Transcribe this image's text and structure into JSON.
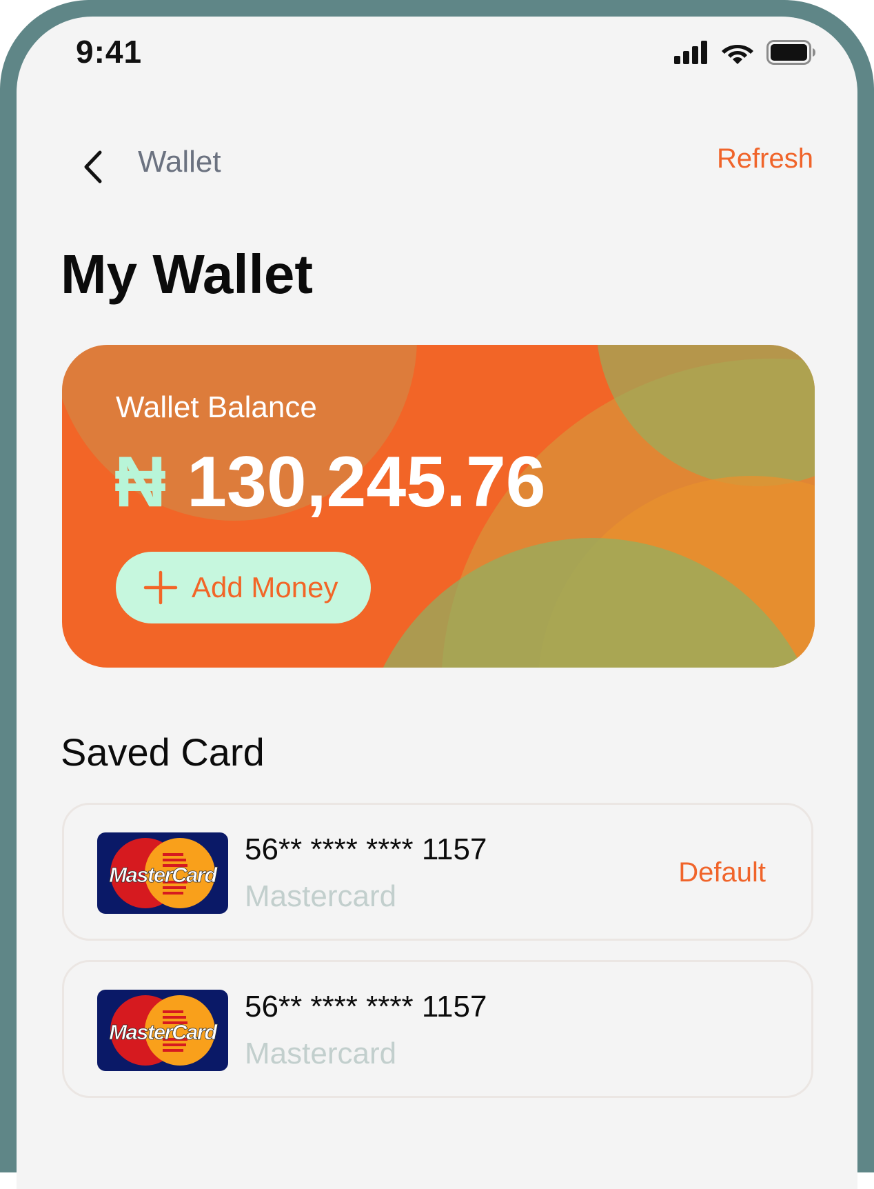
{
  "status_bar": {
    "time": "9:41",
    "icons": [
      "signal-icon",
      "wifi-icon",
      "battery-icon"
    ]
  },
  "nav": {
    "back_icon": "chevron-left-icon",
    "title": "Wallet",
    "refresh_label": "Refresh"
  },
  "page": {
    "title": "My Wallet"
  },
  "balance_card": {
    "label": "Wallet Balance",
    "currency": "₦",
    "amount": "130,245.76",
    "add_money_label": "Add Money",
    "add_icon": "plus-icon"
  },
  "saved_cards": {
    "title": "Saved Card",
    "items": [
      {
        "number": "56** **** **** 1157",
        "brand": "Mastercard",
        "logo_text": "MasterCard",
        "badge": "Default"
      },
      {
        "number": "56** **** **** 1157",
        "brand": "Mastercard",
        "logo_text": "MasterCard",
        "badge": ""
      }
    ]
  },
  "colors": {
    "accent": "#f0642a",
    "card_orange": "#f26527",
    "mint": "#c6f7de",
    "device_frame": "#5f8687",
    "screen_bg": "#f4f4f4"
  }
}
